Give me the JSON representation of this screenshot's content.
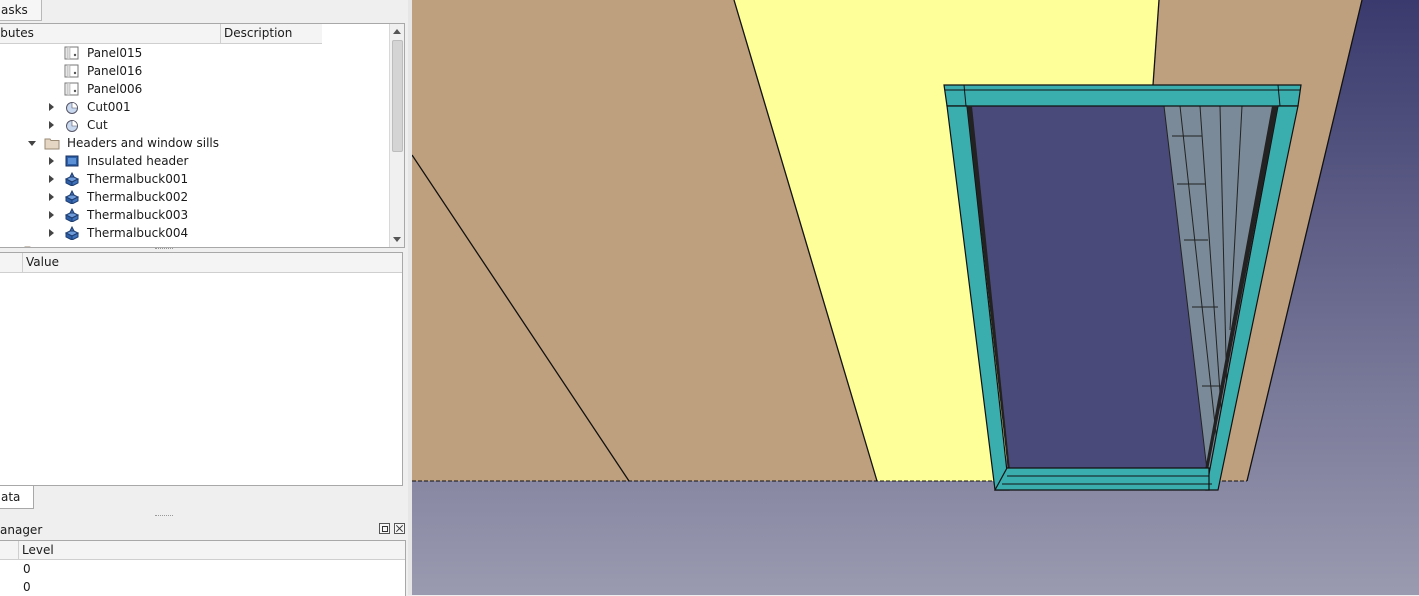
{
  "tabs": {
    "tasks": "asks"
  },
  "tree": {
    "columns": {
      "attributes": "ributes",
      "description": "Description"
    },
    "rows": [
      {
        "label": "Panel015",
        "icon": "panel-icon"
      },
      {
        "label": "Panel016",
        "icon": "panel-icon"
      },
      {
        "label": "Panel006",
        "icon": "panel-icon"
      },
      {
        "label": "Cut001",
        "icon": "cut-icon"
      },
      {
        "label": "Cut",
        "icon": "cut-icon"
      },
      {
        "label": "Headers and window sills",
        "icon": "folder-icon"
      },
      {
        "label": "Insulated header",
        "icon": "header-icon"
      },
      {
        "label": "Thermalbuck001",
        "icon": "part-icon"
      },
      {
        "label": "Thermalbuck002",
        "icon": "part-icon"
      },
      {
        "label": "Thermalbuck003",
        "icon": "part-icon"
      },
      {
        "label": "Thermalbuck004",
        "icon": "part-icon"
      }
    ]
  },
  "properties": {
    "value_header": "Value",
    "tab_label": "ata"
  },
  "layer_manager": {
    "title": "anager",
    "level_header": "Level",
    "levels": [
      "0",
      "0"
    ]
  },
  "colors": {
    "wall": "#bfa07e",
    "highlight": "#ffff99",
    "frame": "#3aaeae",
    "glass": "#7a8a98",
    "sky_top": "#3a3a6e",
    "sky_bottom": "#9a9ab0"
  }
}
